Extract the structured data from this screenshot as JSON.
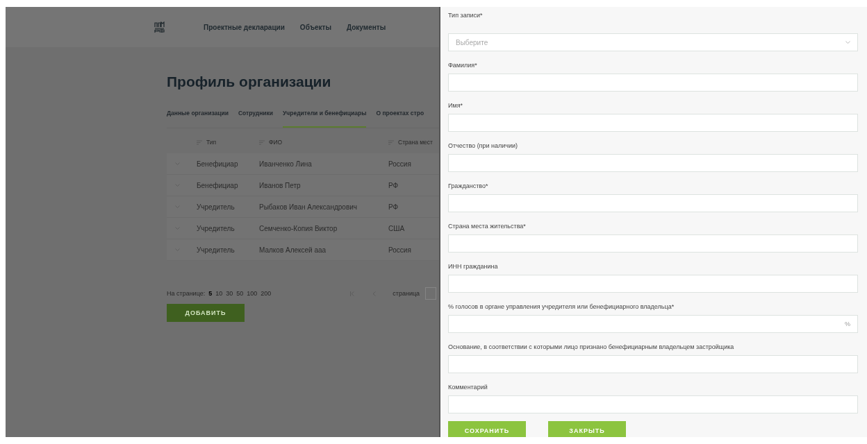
{
  "header": {
    "nav": [
      "Проектные декларации",
      "Объекты",
      "Документы"
    ]
  },
  "page": {
    "title": "Профиль организации",
    "tabs": [
      {
        "label": "Данные организации",
        "selected": false
      },
      {
        "label": "Сотрудники",
        "selected": false
      },
      {
        "label": "Учредители и бенефициары",
        "selected": true
      },
      {
        "label": "О проектах стро",
        "selected": false
      }
    ],
    "table": {
      "columns": [
        "Тип",
        "ФИО",
        "Страна мест"
      ],
      "rows": [
        {
          "cells": [
            "Бенефициар",
            "Иванченко Лина",
            "Россия"
          ]
        },
        {
          "cells": [
            "Бенефициар",
            "Иванов Петр",
            "РФ"
          ]
        },
        {
          "cells": [
            "Учредитель",
            "Рыбаков Иван Александрович",
            "РФ"
          ]
        },
        {
          "cells": [
            "Учредитель",
            "Семченко-Копия Виктор",
            "США"
          ]
        },
        {
          "cells": [
            "Учредитель",
            "Малков Алексей ааа",
            "Россия"
          ]
        }
      ]
    },
    "pagination": {
      "label": "На странице:",
      "sizes": [
        {
          "label": "5",
          "selected": true
        },
        {
          "label": "10",
          "selected": false
        },
        {
          "label": "30",
          "selected": false
        },
        {
          "label": "50",
          "selected": false
        },
        {
          "label": "100",
          "selected": false
        },
        {
          "label": "200",
          "selected": false
        }
      ],
      "page_label": "страница"
    },
    "add_button": "ДОБАВИТЬ"
  },
  "drawer": {
    "fields": [
      {
        "label": "Тип записи*",
        "kind": "select",
        "placeholder": "Выберите"
      },
      {
        "label": "Фамилия*",
        "kind": "text"
      },
      {
        "label": "Имя*",
        "kind": "text"
      },
      {
        "label": "Отчество (при наличии)",
        "kind": "text"
      },
      {
        "label": "Гражданство*",
        "kind": "text"
      },
      {
        "label": "Страна места жительства*",
        "kind": "text"
      },
      {
        "label": "ИНН гражданина",
        "kind": "text"
      },
      {
        "label": "% голосов в органе управления учредителя или бенефициарного владельца*",
        "kind": "suffix",
        "suffix": "%"
      },
      {
        "label": "Основание, в соответствии с которыми лицо признано бенефициарным владельцем застройщика",
        "kind": "text"
      },
      {
        "label": "Комментарий",
        "kind": "text"
      }
    ],
    "buttons": [
      "СОХРАНИТЬ",
      "ЗАКРЫТЬ"
    ]
  }
}
